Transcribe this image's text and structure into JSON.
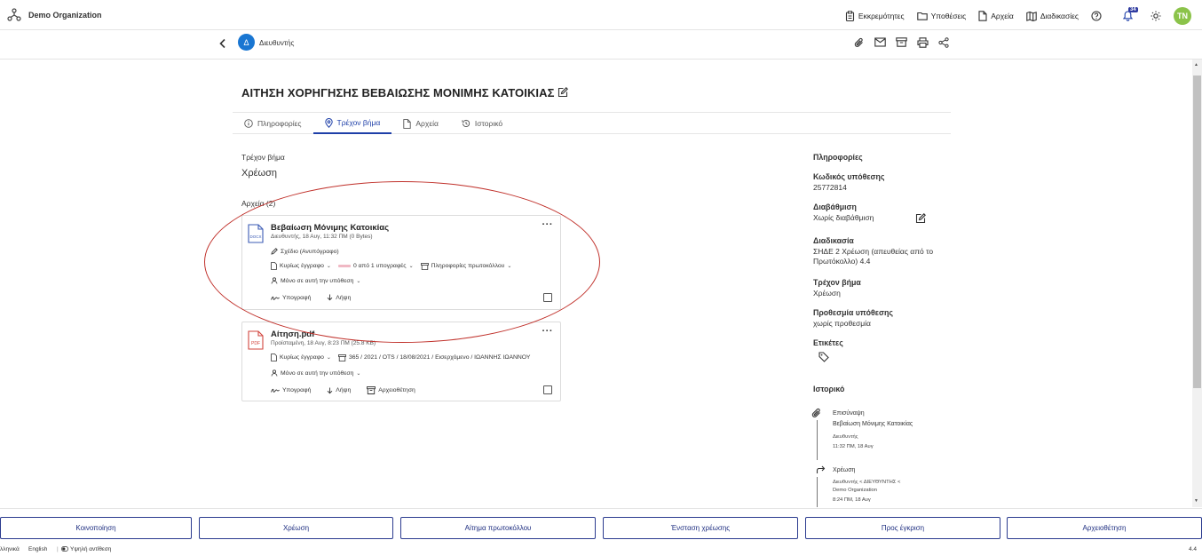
{
  "org": {
    "name": "Demo Organization"
  },
  "topnav": {
    "pending": "Εκκρεμότητες",
    "cases": "Υποθέσεις",
    "files": "Αρχεία",
    "procedures": "Διαδικασίες",
    "notif_count": "34",
    "avatar": "TN"
  },
  "subbar": {
    "avatar_letter": "Δ",
    "label": "Διευθυντής"
  },
  "title": "ΑΙΤΗΣΗ ΧΟΡΗΓΗΣΗΣ ΒΕΒΑΙΩΣΗΣ ΜΟΝΙΜΗΣ ΚΑΤΟΙΚΙΑΣ",
  "tabs": [
    "Πληροφορίες",
    "Τρέχον βήμα",
    "Αρχεία",
    "Ιστορικό"
  ],
  "current_step": {
    "label": "Τρέχον βήμα",
    "value": "Χρέωση"
  },
  "files_header": "Αρχεία  (2)",
  "file1": {
    "title": "Βεβαίωση Μόνιμης Κατοικίας",
    "icon_label": "DOCX",
    "sub": "Διευθυντής, 18 Αυγ, 11:32 ΠΜ (0 Bytes)",
    "draft": "Σχέδιο (Ανυπόγραφο)",
    "main_doc": "Κυρίως έγγραφο",
    "signatures": "0 από 1 υπογραφές",
    "protocol_info": "Πληροφορίες πρωτοκόλλου",
    "scope": "Μόνο σε αυτή την υπόθεση",
    "sign": "Υπογραφή",
    "download": "Λήψη"
  },
  "file2": {
    "title": "Αίτηση.pdf",
    "icon_label": "PDF",
    "sub": "Προϊσταμένη, 18 Αυγ, 8:23 ΠΜ (25.8 KB)",
    "main_doc": "Κυρίως έγγραφο",
    "protocol": "365 / 2021 / OTS / 18/08/2021 / Εισερχόμενο / ΙΩΑΝΝΗΣ ΙΩΑΝΝΟΥ",
    "scope": "Μόνο σε αυτή την υπόθεση",
    "sign": "Υπογραφή",
    "download": "Λήψη",
    "archive": "Αρχειοθέτηση"
  },
  "info_panel": {
    "heading": "Πληροφορίες",
    "case_code_label": "Κωδικός υπόθεσης",
    "case_code": "25772814",
    "grading_label": "Διαβάθμιση",
    "grading": "Χωρίς διαβάθμιση",
    "procedure_label": "Διαδικασία",
    "procedure": "ΣΗΔΕ 2 Χρέωση (απευθείας από το Πρωτόκολλο) 4.4",
    "step_label": "Τρέχον βήμα",
    "step": "Χρέωση",
    "deadline_label": "Προθεσμία υπόθεσης",
    "deadline": "χωρίς προθεσμία",
    "tags_label": "Ετικέτες",
    "history_heading": "Ιστορικό"
  },
  "history": [
    {
      "title": "Επισύναψη",
      "detail": "Βεβαίωση Μόνιμης Κατοικίας",
      "who": "Διευθυντής",
      "when": "11:32 ΠΜ, 18 Αυγ"
    },
    {
      "title": "Χρέωση",
      "who1": "Διευθυντής < ΔΙΕΥΘΥΝΤΗΣ <",
      "who2": "Demo Organization",
      "when": "8:24 ΠΜ, 18 Αυγ"
    }
  ],
  "bottom_buttons": [
    "Κοινοποίηση",
    "Χρέωση",
    "Αίτημα πρωτοκόλλου",
    "Ένσταση χρέωσης",
    "Προς έγκριση",
    "Αρχειοθέτηση"
  ],
  "footer": {
    "lang1": "λληνικά",
    "lang2": "English",
    "contrast": "Υψηλή αντίθεση",
    "version": "4.4"
  },
  "colors": {
    "accent": "#1e3fa8",
    "avatar_green": "#8bc34a",
    "dir_blue": "#1976d2",
    "annotation_red": "#c0302a"
  }
}
